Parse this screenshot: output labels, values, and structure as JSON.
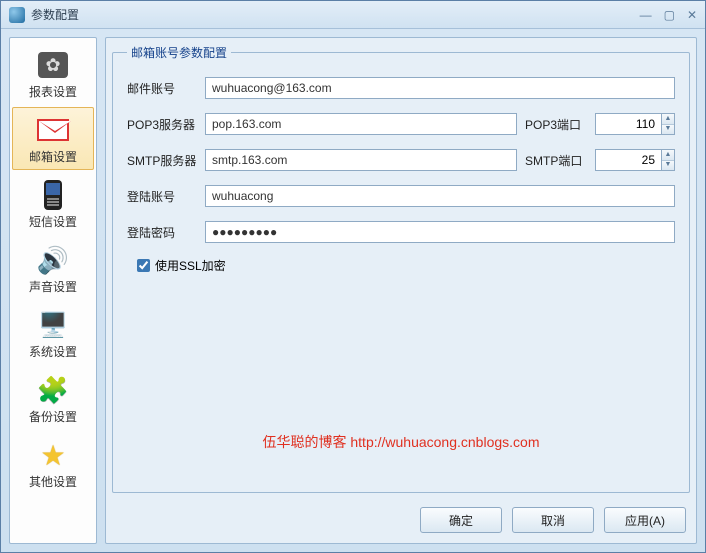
{
  "window": {
    "title": "参数配置"
  },
  "sidebar": {
    "items": [
      {
        "label": "报表设置"
      },
      {
        "label": "邮箱设置"
      },
      {
        "label": "短信设置"
      },
      {
        "label": "声音设置"
      },
      {
        "label": "系统设置"
      },
      {
        "label": "备份设置"
      },
      {
        "label": "其他设置"
      }
    ],
    "selected_index": 1
  },
  "panel": {
    "legend": "邮箱账号参数配置",
    "fields": {
      "mail_account_label": "邮件账号",
      "mail_account": "wuhuacong@163.com",
      "pop3_server_label": "POP3服务器",
      "pop3_server": "pop.163.com",
      "pop3_port_label": "POP3端口",
      "pop3_port": "110",
      "smtp_server_label": "SMTP服务器",
      "smtp_server": "smtp.163.com",
      "smtp_port_label": "SMTP端口",
      "smtp_port": "25",
      "login_account_label": "登陆账号",
      "login_account": "wuhuacong",
      "login_password_label": "登陆密码",
      "login_password": "●●●●●●●●●",
      "ssl_label": "使用SSL加密",
      "ssl_checked": true
    }
  },
  "watermark": "伍华聪的博客 http://wuhuacong.cnblogs.com",
  "buttons": {
    "ok": "确定",
    "cancel": "取消",
    "apply": "应用(A)"
  }
}
